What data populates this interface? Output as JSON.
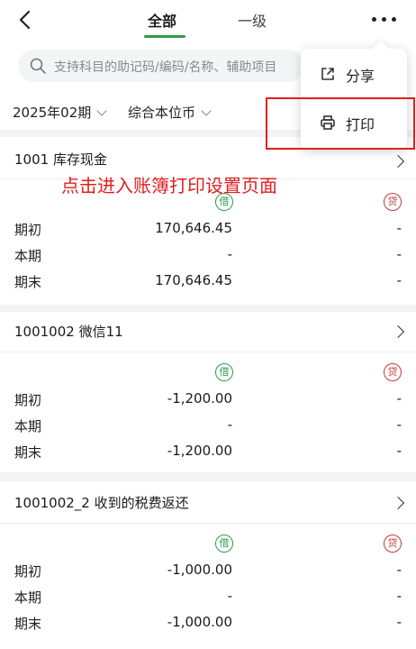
{
  "header": {
    "tabs": [
      {
        "label": "全部",
        "active": true
      },
      {
        "label": "一级",
        "active": false
      }
    ]
  },
  "search": {
    "placeholder": "支持科目的助记码/编码/名称、辅助项目"
  },
  "filters": {
    "period": "2025年02期",
    "currency": "综合本位币"
  },
  "menu": {
    "items": [
      {
        "label": "分享",
        "icon": "share-icon"
      },
      {
        "label": "打印",
        "icon": "printer-icon"
      }
    ]
  },
  "annotation": "点击进入账簿打印设置页面",
  "badges": {
    "debit": "借",
    "credit": "贷"
  },
  "accounts": [
    {
      "title": "1001 库存现金",
      "rows": [
        {
          "label": "期初",
          "debit": "170,646.45",
          "credit": "-"
        },
        {
          "label": "本期",
          "debit": "-",
          "credit": "-"
        },
        {
          "label": "期末",
          "debit": "170,646.45",
          "credit": "-"
        }
      ]
    },
    {
      "title": "1001002 微信11",
      "rows": [
        {
          "label": "期初",
          "debit": "-1,200.00",
          "credit": "-"
        },
        {
          "label": "本期",
          "debit": "-",
          "credit": "-"
        },
        {
          "label": "期末",
          "debit": "-1,200.00",
          "credit": "-"
        }
      ]
    },
    {
      "title": "1001002_2 收到的税费返还",
      "rows": [
        {
          "label": "期初",
          "debit": "-1,000.00",
          "credit": "-"
        },
        {
          "label": "本期",
          "debit": "-",
          "credit": "-"
        },
        {
          "label": "期末",
          "debit": "-1,000.00",
          "credit": "-"
        }
      ]
    }
  ],
  "colors": {
    "accent": "#2f9a4c",
    "credit": "#c23a3a",
    "highlight": "#e02020"
  }
}
